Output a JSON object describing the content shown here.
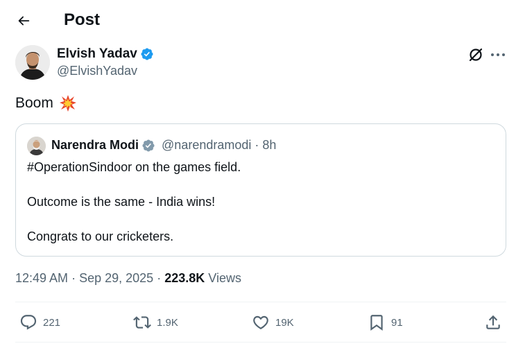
{
  "header": {
    "title": "Post"
  },
  "author": {
    "name": "Elvish Yadav",
    "handle": "@ElvishYadav"
  },
  "tweet": {
    "text": "Boom"
  },
  "quote": {
    "author_name": "Narendra Modi",
    "handle": "@narendramodi",
    "separator": "·",
    "time": "8h",
    "lines": [
      "#OperationSindoor on the games field.",
      "Outcome is the same - India wins!",
      "Congrats to our cricketers."
    ]
  },
  "meta": {
    "time": "12:49 AM",
    "sep1": "·",
    "date": "Sep 29, 2025",
    "sep2": "·",
    "views_count": "223.8K",
    "views_label": "Views"
  },
  "actions": {
    "replies": "221",
    "reposts": "1.9K",
    "likes": "19K",
    "bookmarks": "91"
  },
  "colors": {
    "text": "#0f1419",
    "secondary": "#536471",
    "border": "#cfd9de",
    "verified_blue": "#1d9bf0",
    "verified_gray": "#829aab"
  },
  "icons": [
    "back-arrow-icon",
    "verified-badge-icon",
    "grok-icon",
    "more-icon",
    "collision-emoji-icon",
    "reply-icon",
    "repost-icon",
    "like-icon",
    "bookmark-icon",
    "share-icon"
  ]
}
